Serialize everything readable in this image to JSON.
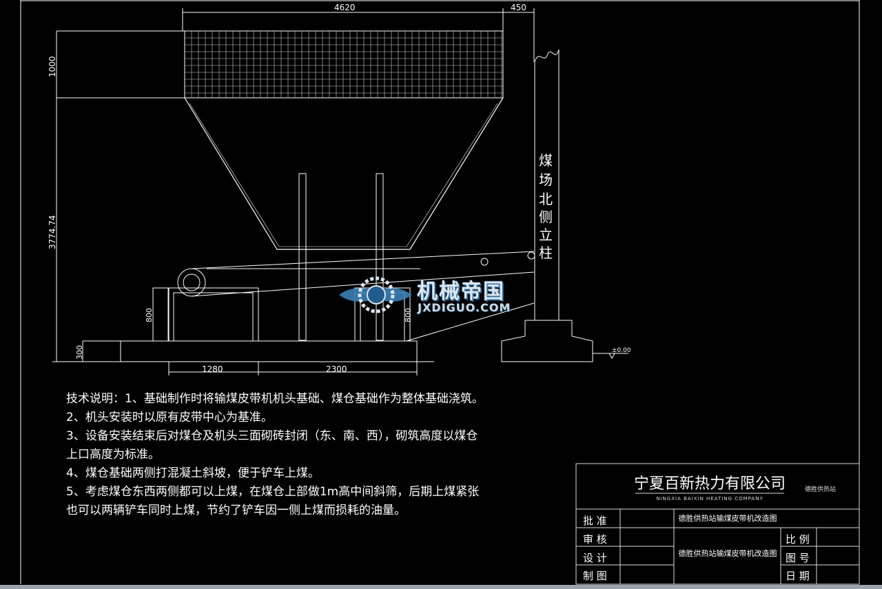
{
  "dimensions": {
    "top_width": "4620",
    "top_right": "450",
    "left_upper": "1000",
    "left_total": "3774.74",
    "head_height": "800",
    "bin_base_height": "800",
    "base_height": "300",
    "bottom_left": "1280",
    "bottom_right": "2300",
    "level": "±0.00"
  },
  "column_label": [
    "煤",
    "场",
    "北",
    "侧",
    "立",
    "柱"
  ],
  "watermark": {
    "cn": "机械帝国",
    "en": "JXDIGUO.COM"
  },
  "notes": [
    "技术说明：1、基础制作时将输煤皮带机机头基础、煤仓基础作为整体基础浇筑。",
    "2、机头安装时以原有皮带中心为基准。",
    "3、设备安装结束后对煤仓及机头三面砌砖封闭（东、南、西），砌筑高度以煤仓",
    "上口高度为标准。",
    "4、煤仓基础两侧打混凝土斜坡，便于铲车上煤。",
    "5、考虑煤仓东西两侧都可以上煤，在煤仓上部做1m高中间斜筛，后期上煤紧张",
    "也可以两辆铲车同时上煤，节约了铲车因一侧上煤而损耗的油量。"
  ],
  "title_block": {
    "company": "宁夏百新热力有限公司",
    "company_en": "NINGXIA BAIXIN HEATING COMPANY",
    "station": "德胜供热站",
    "drawing_title": "德胜供热站输煤皮带机改造图",
    "drawing_title_2": "德胜供热站输煤皮带机改造图",
    "rows": [
      "批 准",
      "审 核",
      "设 计",
      "制 图"
    ],
    "right_labels": [
      "比 例",
      "图 号",
      "日 期"
    ]
  }
}
